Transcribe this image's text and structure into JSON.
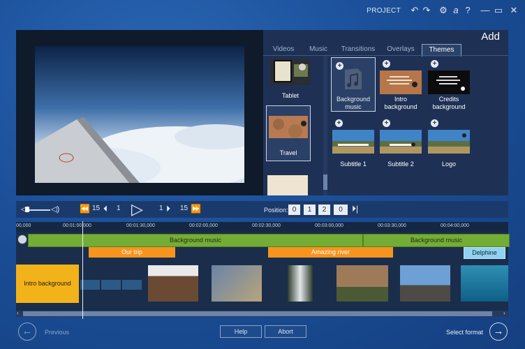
{
  "topbar": {
    "project_label": "PROJECT",
    "undo_icon": "undo-icon",
    "redo_icon": "redo-icon",
    "settings_icon": "gear-icon",
    "account_icon": "a",
    "help_icon": "?",
    "minimize": "—",
    "maximize": "▭",
    "close": "✕"
  },
  "library": {
    "add_label": "Add",
    "tabs": [
      "Videos",
      "Music",
      "Transitions",
      "Overlays",
      "Themes"
    ],
    "active_tab": "Themes",
    "themes": [
      {
        "label": "Tablet"
      },
      {
        "label": "Travel",
        "selected": true
      }
    ],
    "items": [
      {
        "label": "Background music"
      },
      {
        "label": "Intro background"
      },
      {
        "label": "Credits background"
      },
      {
        "label": "Subtitle 1"
      },
      {
        "label": "Subtitle 2"
      },
      {
        "label": "Logo"
      }
    ]
  },
  "transport": {
    "skip_back_seconds": "15",
    "frame_back": "1",
    "frame_forward": "1",
    "skip_forward_seconds": "15",
    "position_label": "Position:",
    "position": [
      "0",
      "1",
      "2",
      "0"
    ]
  },
  "timeline": {
    "ticks": [
      "00,000",
      "00:01:00,000",
      "00:01:30,000",
      "00:02:00,000",
      "00:02:30,000",
      "00:03:00,000",
      "00:03:30,000",
      "00:04:00,000"
    ],
    "music_clips": [
      "Background music",
      "Background music"
    ],
    "title_clips": [
      "Our trip",
      "Amazing river",
      "Delphine"
    ],
    "intro_clip": "Intro background"
  },
  "bottom": {
    "previous_label": "Previous",
    "help_label": "Help",
    "abort_label": "Abort",
    "next_label": "Select format"
  },
  "colors": {
    "accent_green": "#74ad36",
    "title_orange": "#f7941d",
    "intro_yellow": "#f2b21a",
    "subtitle_blue": "#8fd3f0"
  }
}
